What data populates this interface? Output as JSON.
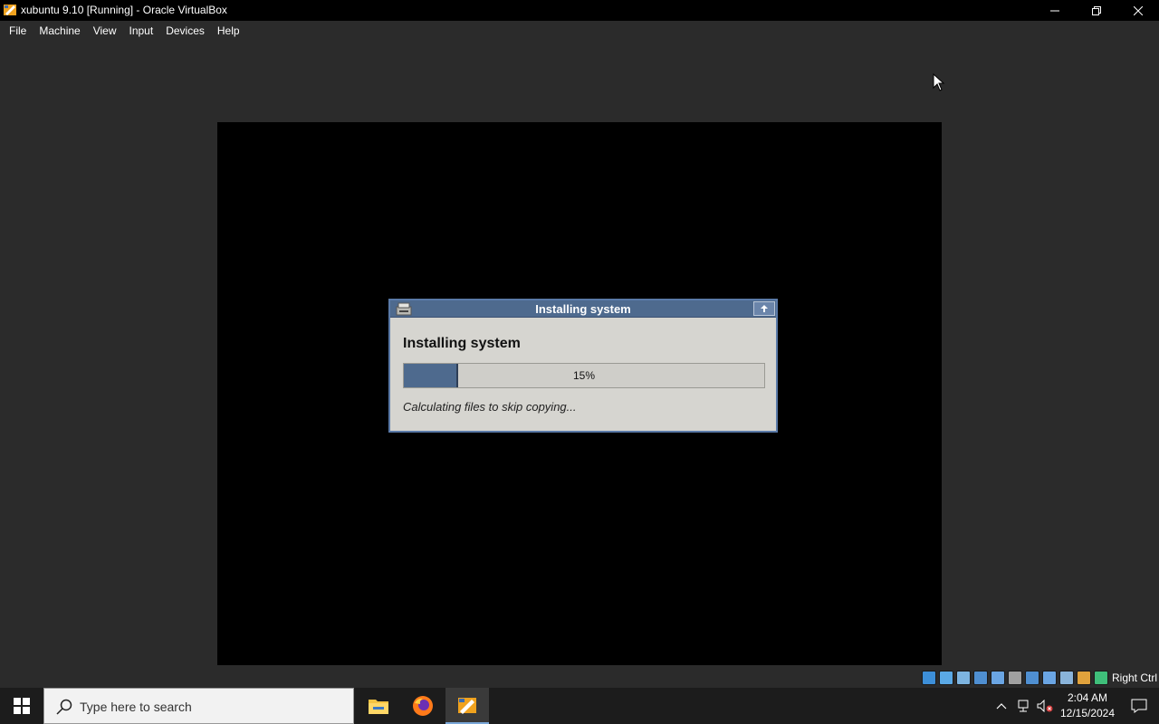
{
  "window": {
    "title": "xubuntu 9.10 [Running] - Oracle VirtualBox",
    "controls": [
      "minimize",
      "restore",
      "close"
    ]
  },
  "menu": {
    "items": [
      {
        "label": "File"
      },
      {
        "label": "Machine"
      },
      {
        "label": "View"
      },
      {
        "label": "Input"
      },
      {
        "label": "Devices"
      },
      {
        "label": "Help"
      }
    ]
  },
  "guest_dialog": {
    "title": "Installing system",
    "heading": "Installing system",
    "progress_percent": 15,
    "progress_label": "15%",
    "status": "Calculating files to skip copying..."
  },
  "statusbar": {
    "icons": [
      "hard-disk-icon",
      "optical-disk-icon",
      "audio-icon",
      "network-icon",
      "usb-icon",
      "shared-folders-icon",
      "display-icon",
      "video-capture-icon",
      "virtualization-icon",
      "mouse-integration-icon",
      "keyboard-icon"
    ],
    "host_key": "Right Ctrl"
  },
  "taskbar": {
    "search_placeholder": "Type here to search",
    "apps": [
      {
        "name": "file-explorer",
        "active": false
      },
      {
        "name": "firefox",
        "active": false
      },
      {
        "name": "virtualbox",
        "active": true
      }
    ],
    "clock_time": "2:04 AM",
    "clock_date": "12/15/2024"
  },
  "colors": {
    "host_background": "#2b2b2b",
    "guest_titlebar": "#4e6a8e",
    "guest_dialog_bg": "#d6d5d0",
    "progress_fill": "#4e6a8e"
  }
}
